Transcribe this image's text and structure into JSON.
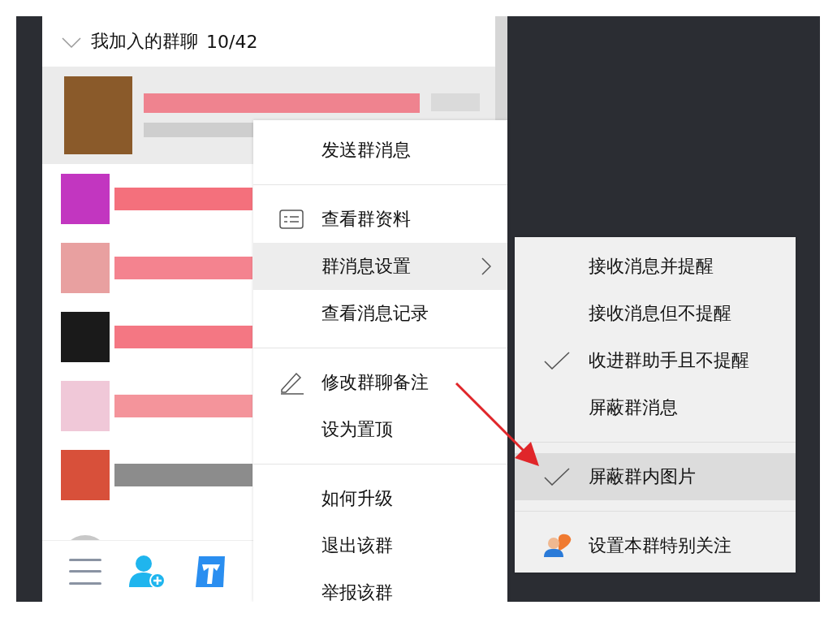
{
  "group_list": {
    "header": {
      "title": "我加入的群聊",
      "count": "10/42",
      "expanded": true
    },
    "rows": [
      {
        "selected": true
      },
      {
        "selected": false
      },
      {
        "selected": false
      },
      {
        "selected": false
      },
      {
        "selected": false
      },
      {
        "selected": false
      },
      {
        "selected": false
      }
    ]
  },
  "context_menu": {
    "groups": [
      [
        {
          "label": "发送群消息",
          "kind": "plain",
          "selected": false
        }
      ],
      [
        {
          "label": "查看群资料",
          "kind": "card",
          "selected": false
        },
        {
          "label": "群消息设置",
          "kind": "submenu",
          "selected": true
        },
        {
          "label": "查看消息记录",
          "kind": "plain",
          "selected": false
        }
      ],
      [
        {
          "label": "修改群聊备注",
          "kind": "pencil",
          "selected": false
        },
        {
          "label": "设为置顶",
          "kind": "plain",
          "selected": false
        }
      ],
      [
        {
          "label": "如何升级",
          "kind": "plain",
          "selected": false
        },
        {
          "label": "退出该群",
          "kind": "plain",
          "selected": false
        },
        {
          "label": "举报该群",
          "kind": "plain",
          "selected": false
        }
      ]
    ]
  },
  "submenu": {
    "groups": [
      [
        {
          "label": "接收消息并提醒",
          "kind": "option",
          "checked": false,
          "selected": false
        },
        {
          "label": "接收消息但不提醒",
          "kind": "option",
          "checked": false,
          "selected": false
        },
        {
          "label": "收进群助手且不提醒",
          "kind": "option",
          "checked": true,
          "selected": false
        },
        {
          "label": "屏蔽群消息",
          "kind": "option",
          "checked": false,
          "selected": false
        }
      ],
      [
        {
          "label": "屏蔽群内图片",
          "kind": "option",
          "checked": true,
          "selected": true
        }
      ],
      [
        {
          "label": "设置本群特别关注",
          "kind": "special",
          "selected": false
        }
      ]
    ]
  }
}
